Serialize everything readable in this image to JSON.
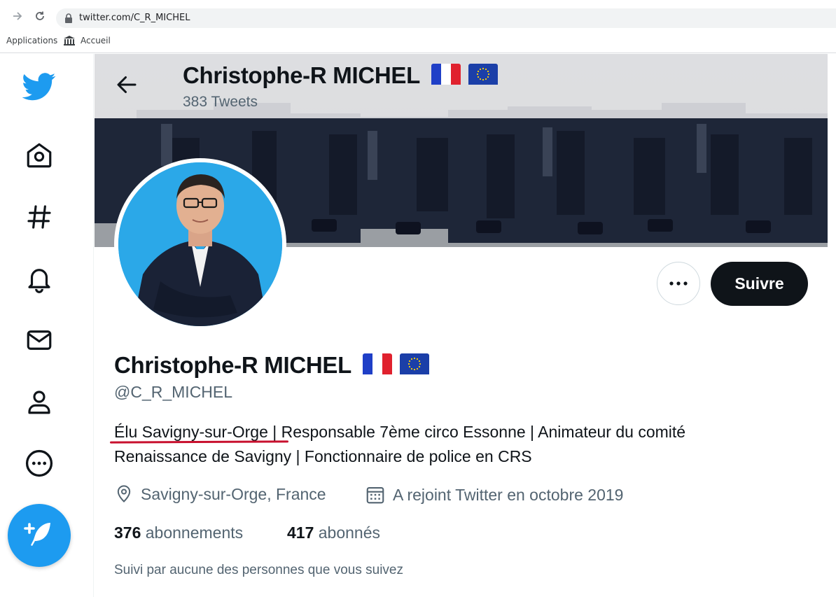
{
  "browser": {
    "url": "twitter.com/C_R_MICHEL",
    "bookmarks": [
      {
        "label": "Applications"
      },
      {
        "label": "Accueil"
      }
    ]
  },
  "nav": {
    "items": [
      {
        "name": "twitter-logo-icon"
      },
      {
        "name": "home-icon"
      },
      {
        "name": "explore-hashtag-icon"
      },
      {
        "name": "notifications-bell-icon"
      },
      {
        "name": "messages-mail-icon"
      },
      {
        "name": "profile-icon"
      },
      {
        "name": "more-icon"
      }
    ],
    "compose_icon": "compose-tweet-icon"
  },
  "header": {
    "name": "Christophe-R MICHEL",
    "tweets": "383 Tweets"
  },
  "profile": {
    "display_name": "Christophe-R MICHEL",
    "handle": "@C_R_MICHEL",
    "bio_line1_part1": "Élu Savigny-sur-Orge",
    "bio_line1_part2": " | Responsable 7ème circo Essonne  | Animateur du comité",
    "bio_line2": "Renaissance de Savigny | Fonctionnaire de police en CRS",
    "location": "Savigny-sur-Orge, France",
    "joined": "A rejoint Twitter en octobre 2019",
    "following_count": "376",
    "following_label": "abonnements",
    "followers_count": "417",
    "followers_label": "abonnés",
    "followed_by": "Suivi par aucune des personnes que vous suivez",
    "follow_button": "Suivre"
  },
  "colors": {
    "accent": "#1d9bf0",
    "text": "#0f1419",
    "secondary": "#536471",
    "annotation_underline": "#c8102e"
  }
}
